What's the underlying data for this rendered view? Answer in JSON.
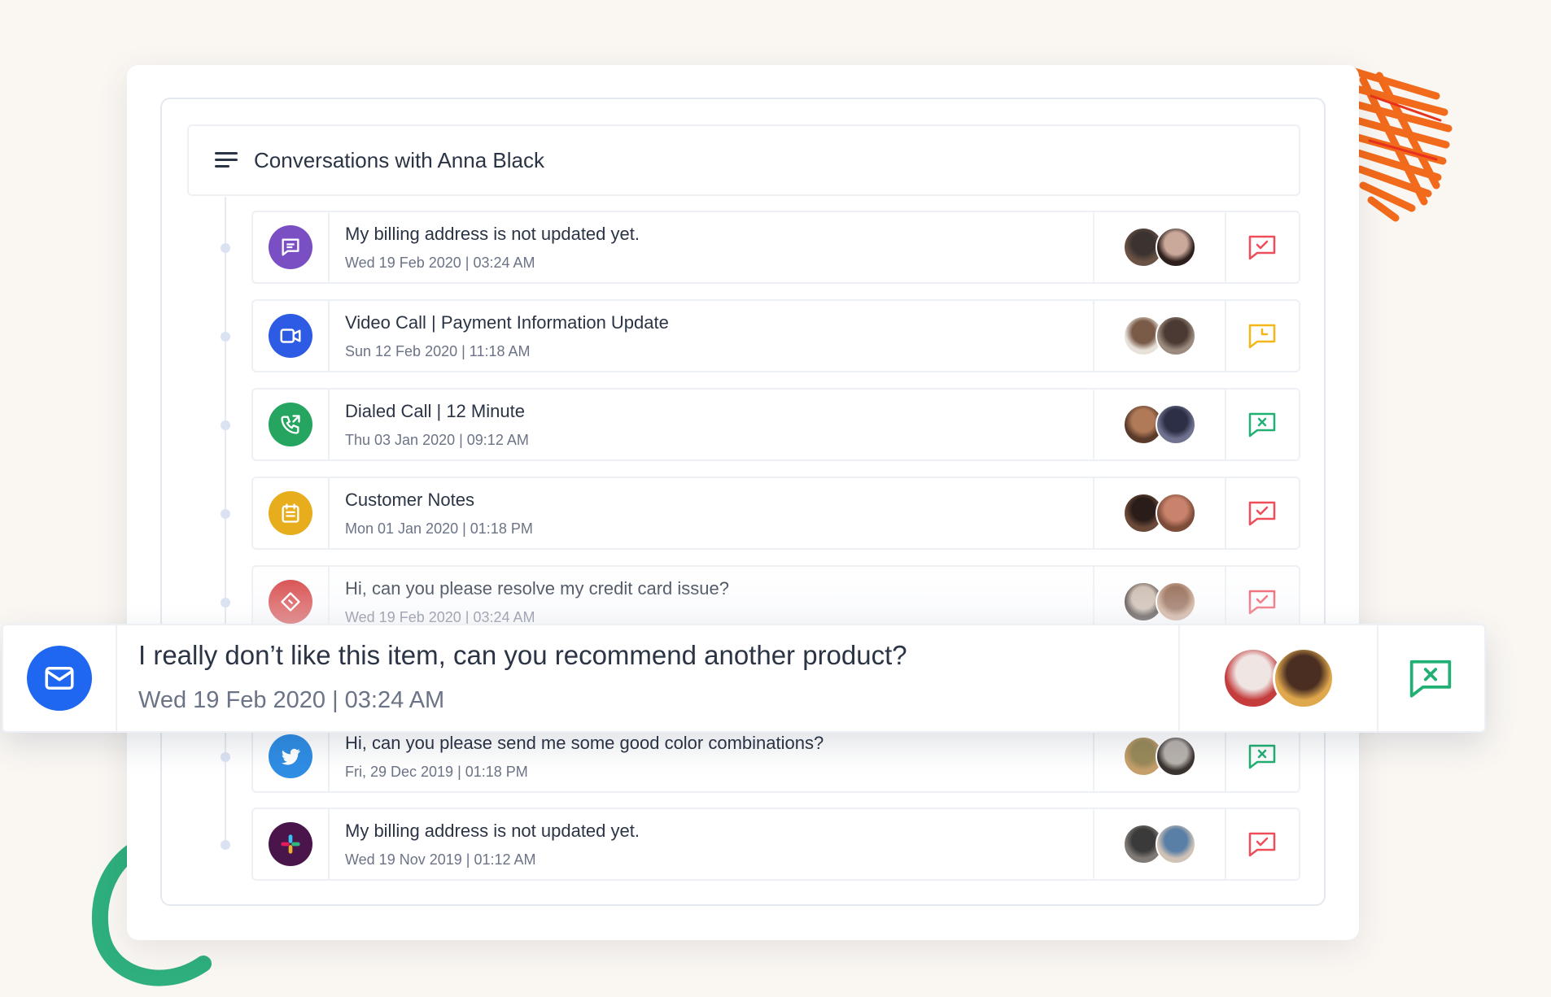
{
  "header": {
    "title": "Conversations with Anna Black",
    "icon": "list-menu-icon"
  },
  "conversations": [
    {
      "title": "My billing address is not updated yet.",
      "meta": "Wed 19 Feb 2020  |  03:24 AM",
      "channel_icon": "chat-bubble-icon",
      "channel_color": "#7a4fc4",
      "status": "resolved",
      "status_color": "#ef4d5a",
      "avatars": [
        {
          "bg": "#3b3330",
          "ring": "#6a5245"
        },
        {
          "bg": "#caa89a",
          "ring": "#2c1f1c"
        }
      ]
    },
    {
      "title": "Video Call  |  Payment Information Update",
      "meta": "Sun 12 Feb 2020  |  11:18 AM",
      "channel_icon": "video-camera-icon",
      "channel_color": "#2d5be3",
      "status": "pending",
      "status_color": "#f5b617",
      "avatars": [
        {
          "bg": "#7a5b48",
          "ring": "#e8e1da"
        },
        {
          "bg": "#4a3a33",
          "ring": "#9b8a7d"
        }
      ]
    },
    {
      "title": "Dialed Call  |  12 Minute",
      "meta": "Thu 03 Jan 2020  |  09:12 AM",
      "channel_icon": "phone-call-icon",
      "channel_color": "#25a55f",
      "status": "closed",
      "status_color": "#21b073",
      "avatars": [
        {
          "bg": "#b07a58",
          "ring": "#5a3a2a"
        },
        {
          "bg": "#2c2f45",
          "ring": "#6f7390"
        }
      ]
    },
    {
      "title": "Customer Notes",
      "meta": "Mon 01 Jan 2020  |  01:18 PM",
      "channel_icon": "notes-icon",
      "channel_color": "#e7ad1c",
      "status": "resolved",
      "status_color": "#ef4d5a",
      "avatars": [
        {
          "bg": "#2a1c18",
          "ring": "#6b4a3a"
        },
        {
          "bg": "#c9826b",
          "ring": "#7d4d3a"
        }
      ]
    },
    {
      "title": "Hi, can you please resolve my credit card issue?",
      "meta": "Wed 19 Feb 2020  |  03:24 AM",
      "channel_icon": "ticket-icon",
      "channel_color": "#d53c3c",
      "status": "resolved",
      "status_color": "#ef4d5a",
      "avatars": [
        {
          "bg": "#c7b5a6",
          "ring": "#3a2f2a"
        },
        {
          "bg": "#8a5a40",
          "ring": "#c9a38a"
        }
      ]
    },
    {
      "title": "Hi, can you please send me some good color combinations?",
      "meta": "Fri, 29 Dec 2019  |  01:18 PM",
      "channel_icon": "twitter-icon",
      "channel_color": "#2f8de4",
      "status": "closed",
      "status_color": "#21b073",
      "avatars": [
        {
          "bg": "#9a8a5a",
          "ring": "#c6a06b"
        },
        {
          "bg": "#b9b3ad",
          "ring": "#3a3330"
        }
      ]
    },
    {
      "title": "My billing address is not updated yet.",
      "meta": "Wed 19 Nov 2019  |  01:12 AM",
      "channel_icon": "slack-icon",
      "channel_color": "#4a154b",
      "status": "resolved",
      "status_color": "#ef4d5a",
      "avatars": [
        {
          "bg": "#3a3a3a",
          "ring": "#807a76"
        },
        {
          "bg": "#5a7fa6",
          "ring": "#d0c3b6"
        }
      ]
    }
  ],
  "highlight": {
    "title": "I really don’t like this item, can you recommend another product?",
    "meta": "Wed 19 Feb 2020  |  03:24 AM",
    "channel_icon": "mail-icon",
    "channel_color": "#1f67f0",
    "status": "closed",
    "status_color": "#21b073",
    "avatars": [
      {
        "bg": "#efe6e4",
        "ring": "#c43c3c"
      },
      {
        "bg": "#4a2e22",
        "ring": "#e0a84c"
      }
    ]
  },
  "colors": {
    "decor_orange": "#f26a1b",
    "decor_green": "#2eaf7d"
  }
}
